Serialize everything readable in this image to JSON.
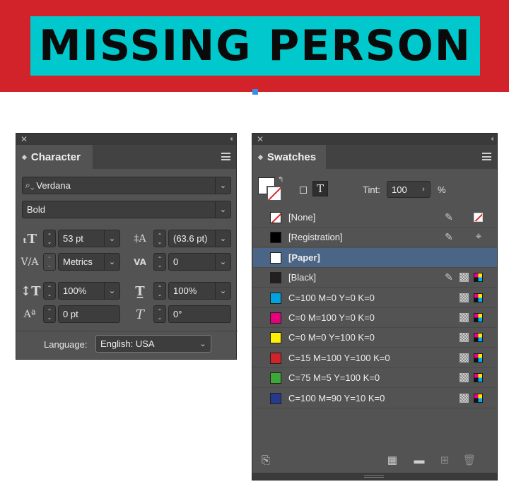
{
  "banner": {
    "headline": "MISSING PERSON",
    "bg_color": "#d2232b",
    "frame_color": "#00c8cc"
  },
  "character_panel": {
    "tab_label": "Character",
    "font_family": "Verdana",
    "font_style": "Bold",
    "font_size": "53 pt",
    "leading": "(63.6 pt)",
    "kerning": "Metrics",
    "tracking": "0",
    "vertical_scale": "100%",
    "horizontal_scale": "100%",
    "baseline_shift": "0 pt",
    "skew": "0°",
    "language_label": "Language:",
    "language": "English: USA"
  },
  "swatches_panel": {
    "tab_label": "Swatches",
    "tint_label": "Tint:",
    "tint_value": "100",
    "tint_unit": "%",
    "swatches": [
      {
        "name": "[None]",
        "color": "none",
        "lock": true,
        "indicator": "none"
      },
      {
        "name": "[Registration]",
        "color": "#000000",
        "lock": true,
        "indicator": "registration"
      },
      {
        "name": "[Paper]",
        "color": "#ffffff",
        "lock": false,
        "indicator": "",
        "selected": true
      },
      {
        "name": "[Black]",
        "color": "#231f20",
        "lock": true,
        "indicator": "cmyk"
      },
      {
        "name": "C=100 M=0 Y=0 K=0",
        "color": "#00a3e0",
        "lock": false,
        "indicator": "cmyk"
      },
      {
        "name": "C=0 M=100 Y=0 K=0",
        "color": "#e6007e",
        "lock": false,
        "indicator": "cmyk"
      },
      {
        "name": "C=0 M=0 Y=100 K=0",
        "color": "#fff200",
        "lock": false,
        "indicator": "cmyk"
      },
      {
        "name": "C=15 M=100 Y=100 K=0",
        "color": "#d2232b",
        "lock": false,
        "indicator": "cmyk"
      },
      {
        "name": "C=75 M=5 Y=100 K=0",
        "color": "#3aa935",
        "lock": false,
        "indicator": "cmyk"
      },
      {
        "name": "C=100 M=90 Y=10 K=0",
        "color": "#263a8c",
        "lock": false,
        "indicator": "cmyk"
      }
    ]
  }
}
